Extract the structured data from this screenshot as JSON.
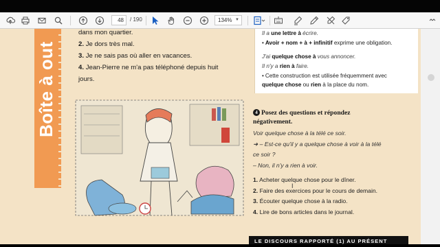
{
  "toolbar": {
    "page_current": "48",
    "page_total": "/ 190",
    "zoom": "134%",
    "icons": [
      "upload-icon",
      "print-icon",
      "mail-icon",
      "search-icon",
      "page-up-icon",
      "page-down-icon",
      "select-cursor-icon",
      "hand-icon",
      "zoom-out-icon",
      "zoom-in-icon",
      "fit-page-icon",
      "keyboard-icon",
      "highlight-icon",
      "sign-icon",
      "erase-icon",
      "stamp-icon",
      "more-icon"
    ]
  },
  "page": {
    "band_text": "Boîte à out",
    "intro": [
      {
        "num": "",
        "text": "dans mon quartier."
      },
      {
        "num": "2.",
        "text": "Je dors très mal."
      },
      {
        "num": "3.",
        "text": "Je ne sais pas où aller en vacances."
      },
      {
        "num": "4.",
        "text": "Jean-Pierre ne m'a pas téléphoné depuis huit"
      },
      {
        "num": "",
        "text": "jours."
      }
    ],
    "grammar_box": {
      "l1_a": "Il a ",
      "l1_b": "une lettre à",
      "l1_c": " écrire.",
      "l2_a": "Avoir + nom + à + infinitif",
      "l2_b": " exprime une obligation.",
      "l3_a": "J'ai ",
      "l3_b": "quelque chose à",
      "l3_c": " vous annoncer.",
      "l4_a": "Il n'y a ",
      "l4_b": "rien à",
      "l4_c": " faire.",
      "l5": "Cette construction est utilisée fréquemment avec",
      "l6_a": "quelque chose",
      "l6_b": " ou ",
      "l6_c": "rien",
      "l6_d": " à la place du nom."
    },
    "exercise": {
      "number": "4",
      "title_1": "Posez des questions et répondez",
      "title_2": "négativement.",
      "example_1": "Voir quelque chose à la télé ce soir.",
      "example_2": "➜ – Est-ce qu'il y a quelque chose à voir à la télé",
      "example_3": "ce soir ?",
      "example_4": "– Non, il n'y a rien à voir.",
      "items": [
        {
          "num": "1.",
          "text": "Acheter quelque chose pour le dîner."
        },
        {
          "num": "2.",
          "text": "Faire des exercices pour le cours de demain."
        },
        {
          "num": "3.",
          "text": "Écouter quelque chose à la radio."
        },
        {
          "num": "4.",
          "text": "Lire de bons articles dans le journal."
        }
      ]
    },
    "footer": "LE DISCOURS RAPPORTÉ (1) AU PRÉSENT"
  }
}
